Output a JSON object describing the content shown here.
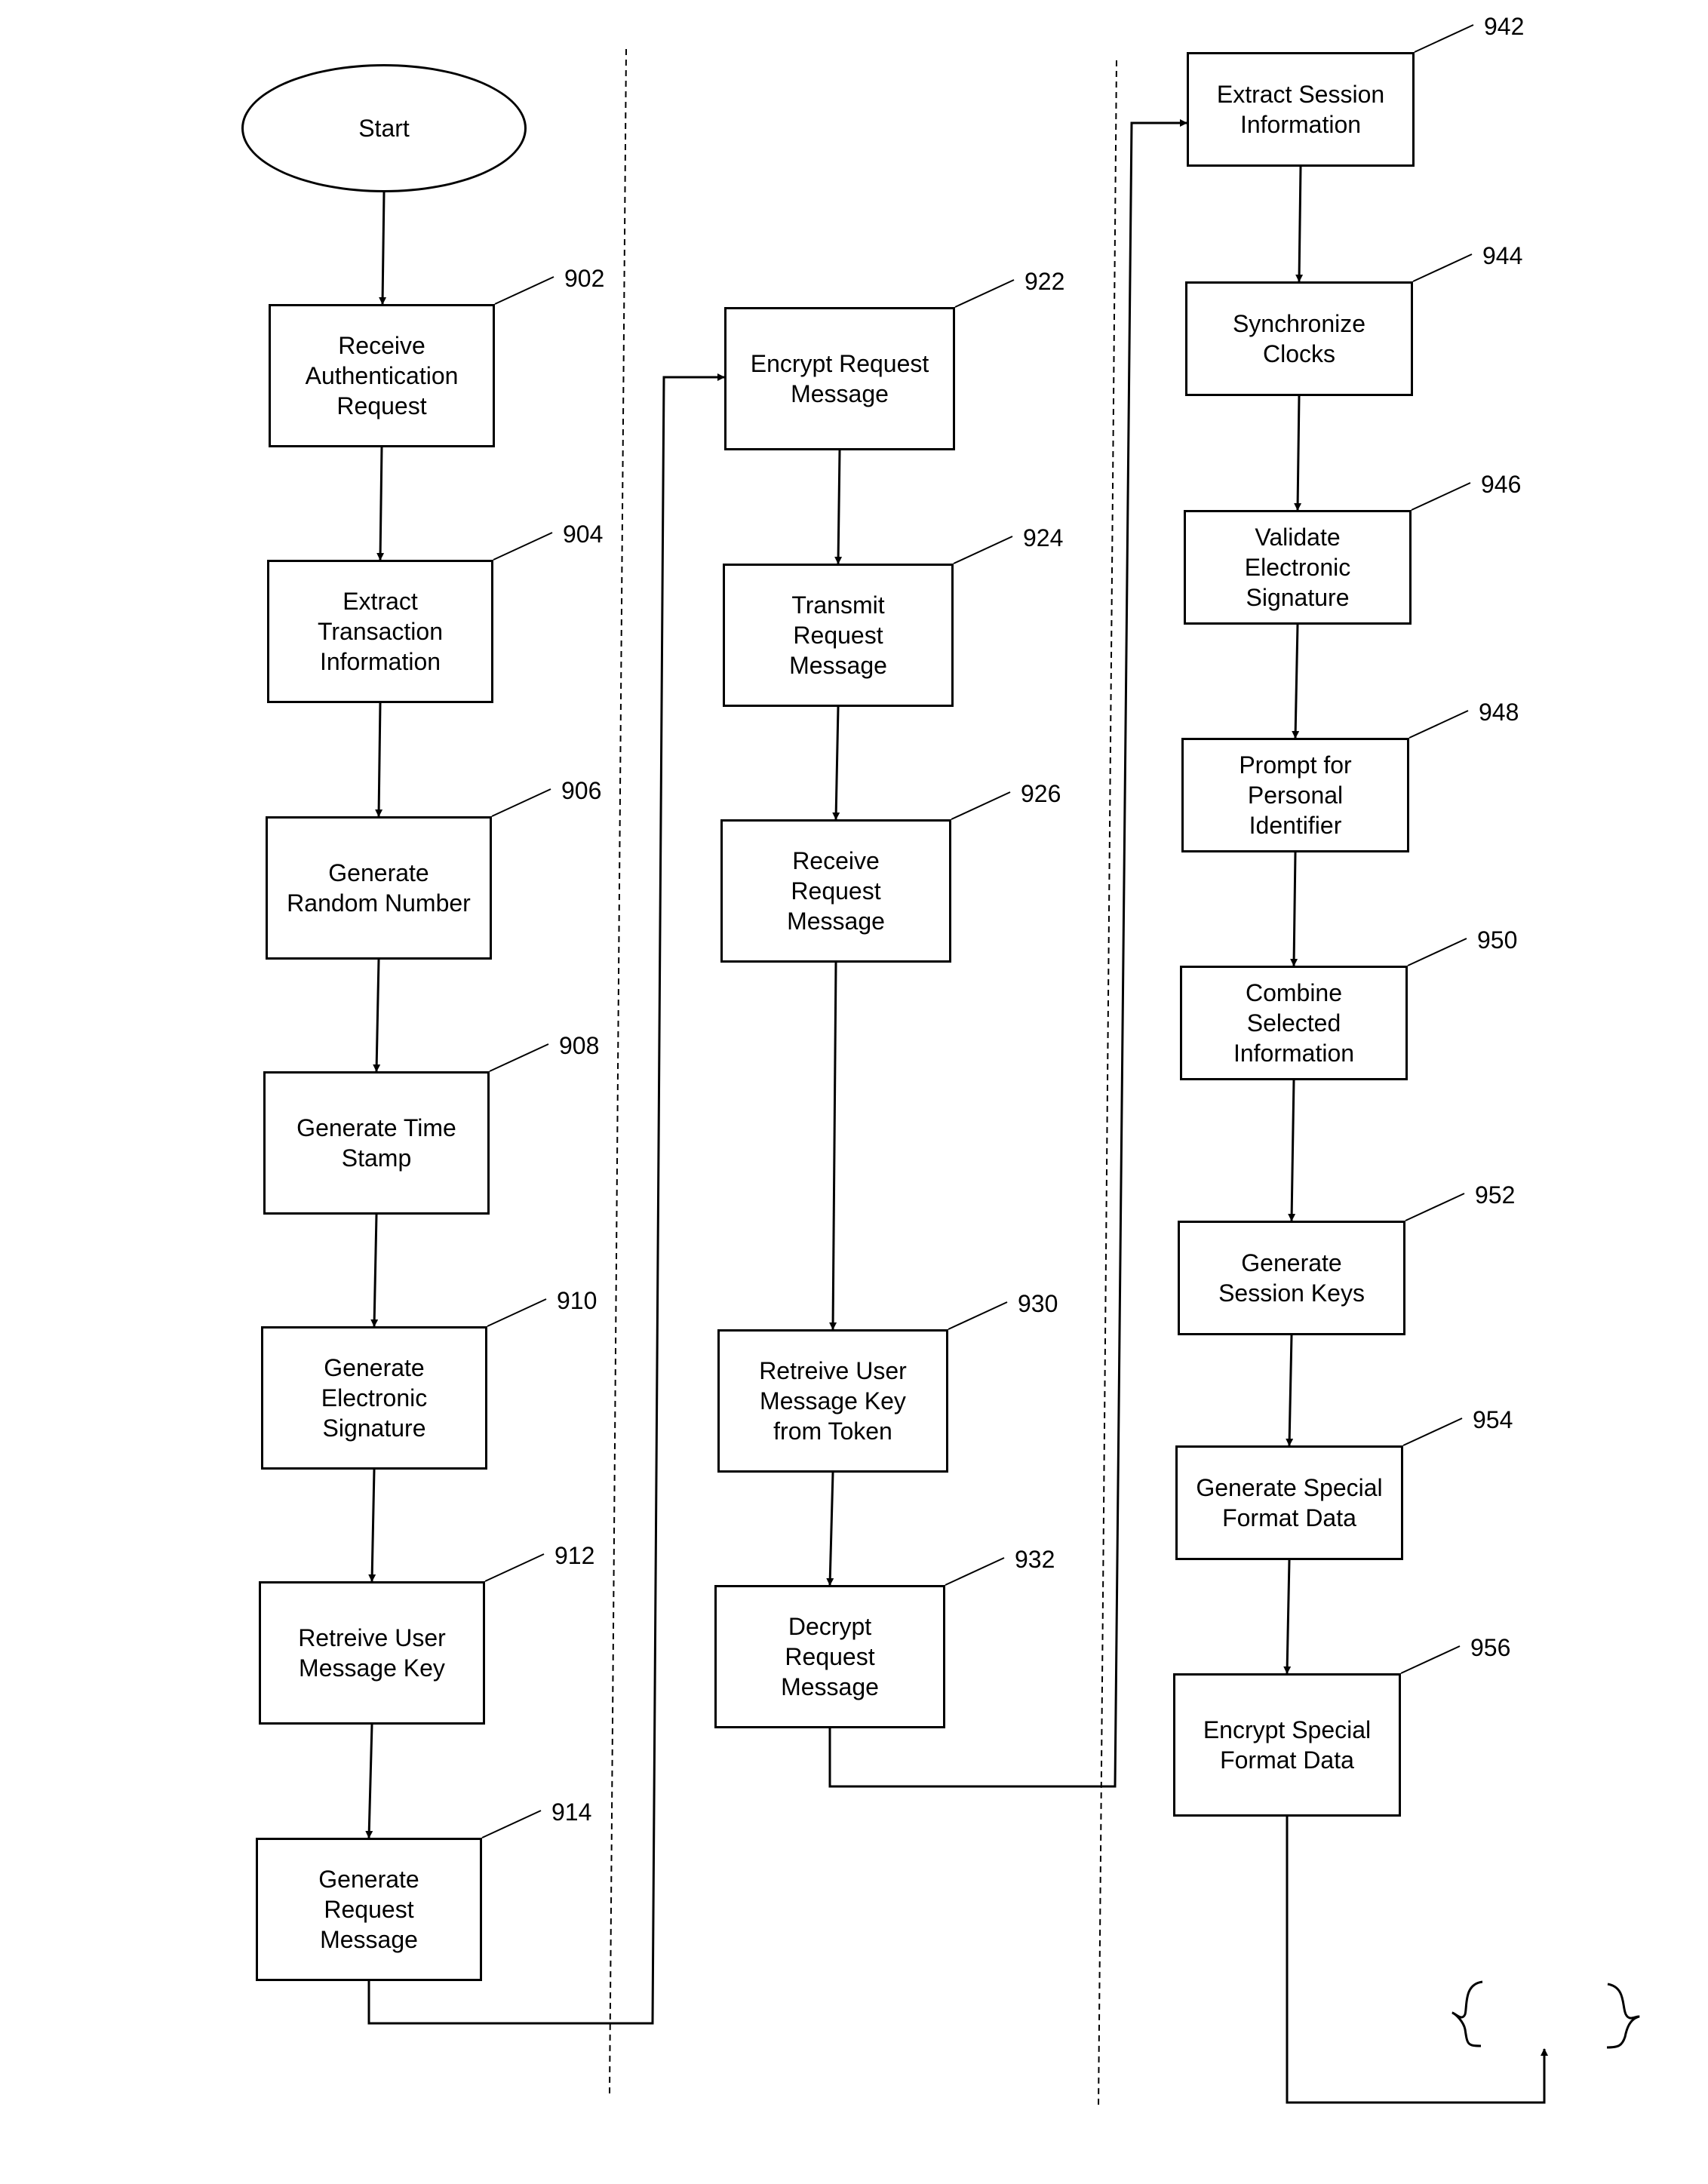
{
  "start": {
    "label": "Start"
  },
  "column1": [
    {
      "ref": "902",
      "label": "Receive\nAuthentication\nRequest"
    },
    {
      "ref": "904",
      "label": "Extract\nTransaction\nInformation"
    },
    {
      "ref": "906",
      "label": "Generate\nRandom Number"
    },
    {
      "ref": "908",
      "label": "Generate Time\nStamp"
    },
    {
      "ref": "910",
      "label": "Generate\nElectronic\nSignature"
    },
    {
      "ref": "912",
      "label": "Retreive User\nMessage Key"
    },
    {
      "ref": "914",
      "label": "Generate\nRequest\nMessage"
    }
  ],
  "column2": [
    {
      "ref": "922",
      "label": "Encrypt  Request\nMessage"
    },
    {
      "ref": "924",
      "label": "Transmit\nRequest\nMessage"
    },
    {
      "ref": "926",
      "label": "Receive\nRequest\nMessage"
    },
    {
      "ref": "930",
      "label": "Retreive User\nMessage Key\nfrom Token"
    },
    {
      "ref": "932",
      "label": "Decrypt\nRequest\nMessage"
    }
  ],
  "column3": [
    {
      "ref": "942",
      "label": "Extract Session\nInformation"
    },
    {
      "ref": "944",
      "label": "Synchronize\nClocks"
    },
    {
      "ref": "946",
      "label": "Validate\nElectronic\nSignature"
    },
    {
      "ref": "948",
      "label": "Prompt for\nPersonal\nIdentifier"
    },
    {
      "ref": "950",
      "label": "Combine\nSelected\nInformation"
    },
    {
      "ref": "952",
      "label": "Generate\nSession Keys"
    },
    {
      "ref": "954",
      "label": "Generate Special\nFormat Data"
    },
    {
      "ref": "956",
      "label": "Encrypt Special\nFormat Data"
    }
  ]
}
